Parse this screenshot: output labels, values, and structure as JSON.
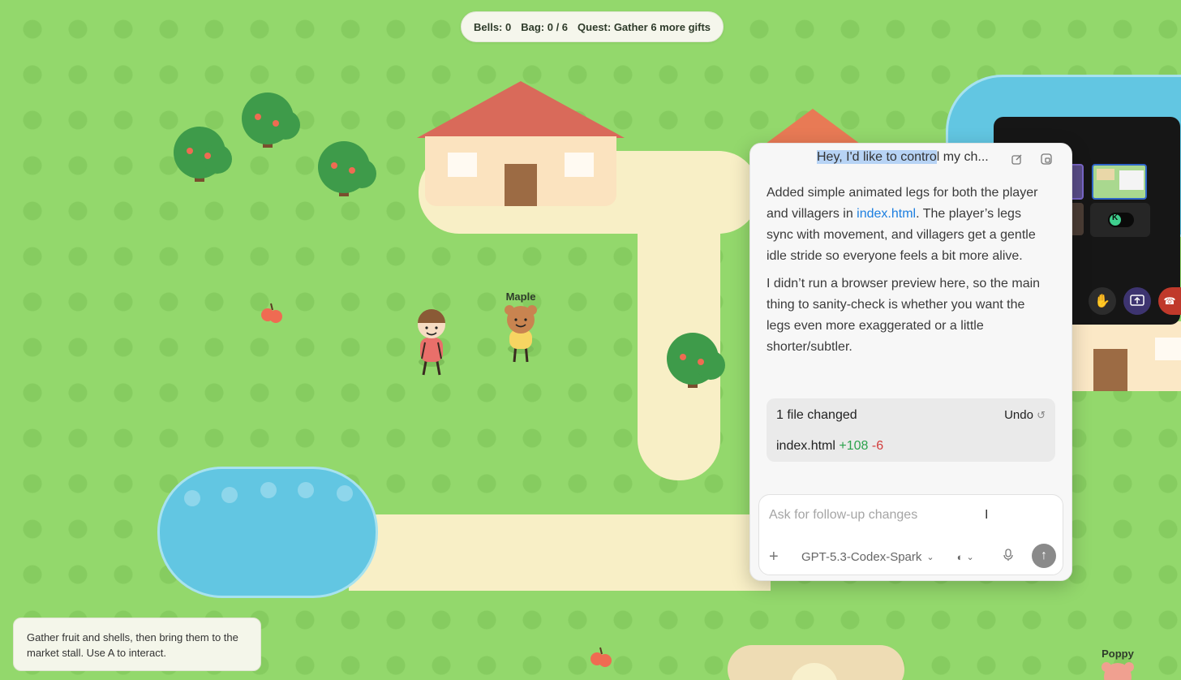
{
  "hud": {
    "bells": "Bells: 0",
    "bag": "Bag: 0 / 6",
    "quest": "Quest: Gather 6 more gifts"
  },
  "characters": {
    "villager_1": "Maple",
    "villager_2": "Poppy"
  },
  "tooltip": {
    "text": "Gather fruit and shells, then bring them to the market stall. Use A to interact."
  },
  "chat": {
    "title_highlighted": "Hey, I'd like to contro",
    "title_rest": "l my ch...",
    "para1_before": "Added simple animated legs for both the player and villagers in ",
    "para1_link": "index.html",
    "para1_after": ". The player’s legs sync with movement, and villagers get a gentle idle stride so everyone feels a bit more alive.",
    "para2": "I didn’t run a browser preview here, so the main thing to sanity-check is whether you want the legs even more exaggerated or a little shorter/subtler.",
    "changes": {
      "summary": "1 file changed",
      "undo_label": "Undo",
      "file": "index.html",
      "additions": "+108",
      "deletions": "-6"
    },
    "composer": {
      "placeholder": "Ask for follow-up changes",
      "model": "GPT-5.3-Codex-Spark"
    }
  },
  "call": {
    "avatar_initial": "K"
  },
  "colors": {
    "grass": "#93d86c",
    "path": "#f8efc6",
    "water": "#62c6e2",
    "roof": "#d96a5a",
    "link": "#1d7fe0"
  }
}
